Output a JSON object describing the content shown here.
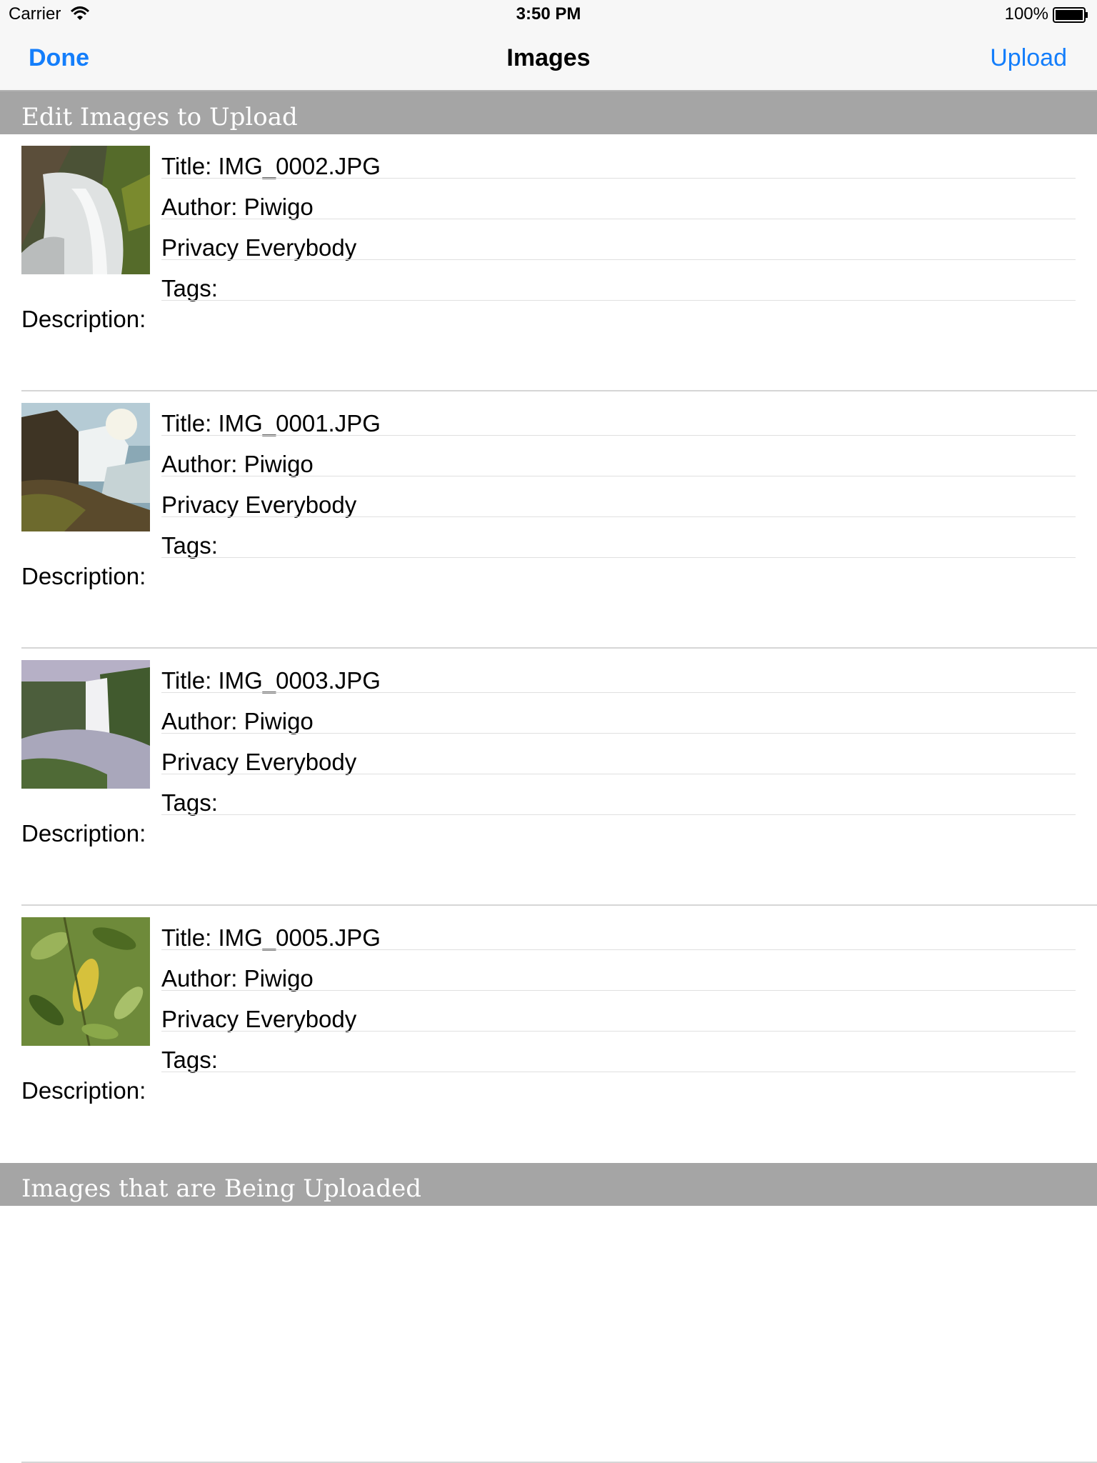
{
  "status_bar": {
    "carrier": "Carrier",
    "time": "3:50 PM",
    "battery": "100%",
    "wifi_icon": "wifi-icon",
    "battery_icon": "battery-icon"
  },
  "nav": {
    "left_label": "Done",
    "title": "Images",
    "right_label": "Upload"
  },
  "sections": {
    "edit_header": "Edit Images to Upload",
    "uploading_header": "Images that are Being Uploaded"
  },
  "images": [
    {
      "title": "Title: IMG_0002.JPG",
      "author": "Author: Piwigo",
      "privacy": "Privacy Everybody",
      "tags": "Tags:",
      "description": "Description:"
    },
    {
      "title": "Title: IMG_0001.JPG",
      "author": "Author: Piwigo",
      "privacy": "Privacy Everybody",
      "tags": "Tags:",
      "description": "Description:"
    },
    {
      "title": "Title: IMG_0003.JPG",
      "author": "Author: Piwigo",
      "privacy": "Privacy Everybody",
      "tags": "Tags:",
      "description": "Description:"
    },
    {
      "title": "Title: IMG_0005.JPG",
      "author": "Author: Piwigo",
      "privacy": "Privacy Everybody",
      "tags": "Tags:",
      "description": "Description:"
    }
  ],
  "colors": {
    "accent": "#147efb",
    "section_bg": "#a5a5a5",
    "bar_bg": "#f7f7f7"
  }
}
